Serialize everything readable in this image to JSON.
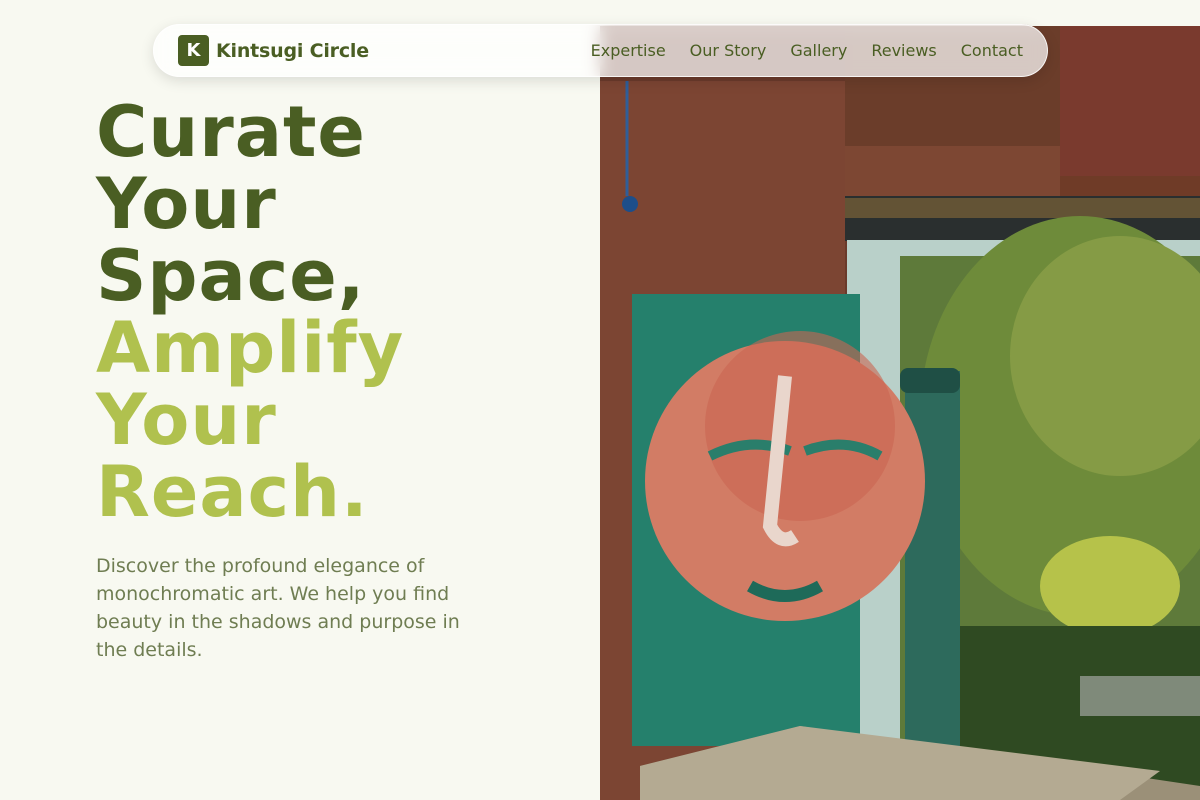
{
  "brand": {
    "logo_letter": "K",
    "name": "Kintsugi Circle",
    "color": "#4a5e23"
  },
  "nav": {
    "links": [
      "Expertise",
      "Our Story",
      "Gallery",
      "Reviews",
      "Contact"
    ]
  },
  "hero": {
    "headline_dark": [
      "Curate",
      "Your",
      "Space,"
    ],
    "headline_light": [
      "Amplify",
      "Your",
      "Reach."
    ],
    "tagline": "Discover the profound elegance of monochromatic art. We help you find beauty in the shadows and purpose in the details.",
    "colors": {
      "dark_green": "#4a5e23",
      "light_green": "#b0c14e",
      "tagline": "#6f7d52",
      "background": "#f8f9f1"
    },
    "image": {
      "subject": "painted face artwork on a teal panel in a rusty frame with trees behind"
    }
  }
}
